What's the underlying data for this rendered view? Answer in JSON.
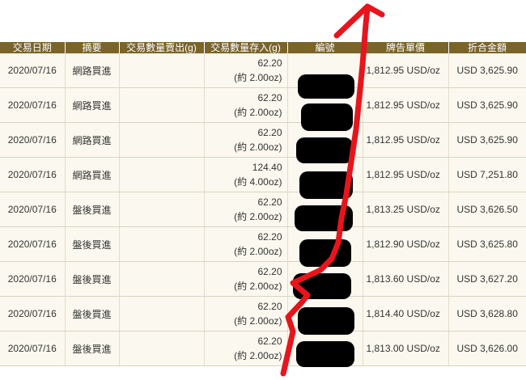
{
  "table": {
    "headers": [
      "交易日期",
      "摘要",
      "交易數量賣出(g)",
      "交易數量存入(g)",
      "編號",
      "牌告單價",
      "折合金額"
    ],
    "rows": [
      {
        "date": "2020/07/16",
        "summary": "網路買進",
        "qty_g": "62.20",
        "qty_oz": "(約 2.00oz)",
        "price": "1,812.95 USD/oz",
        "amount": "USD 3,625.90"
      },
      {
        "date": "2020/07/16",
        "summary": "網路買進",
        "qty_g": "62.20",
        "qty_oz": "(約 2.00oz)",
        "price": "1,812.95 USD/oz",
        "amount": "USD 3,625.90"
      },
      {
        "date": "2020/07/16",
        "summary": "網路買進",
        "qty_g": "62.20",
        "qty_oz": "(約 2.00oz)",
        "price": "1,812.95 USD/oz",
        "amount": "USD 3,625.90"
      },
      {
        "date": "2020/07/16",
        "summary": "網路買進",
        "qty_g": "124.40",
        "qty_oz": "(約 4.00oz)",
        "price": "1,812.95 USD/oz",
        "amount": "USD 7,251.80"
      },
      {
        "date": "2020/07/16",
        "summary": "盤後買進",
        "qty_g": "62.20",
        "qty_oz": "(約 2.00oz)",
        "price": "1,813.25 USD/oz",
        "amount": "USD 3,626.50"
      },
      {
        "date": "2020/07/16",
        "summary": "盤後買進",
        "qty_g": "62.20",
        "qty_oz": "(約 2.00oz)",
        "price": "1,812.90 USD/oz",
        "amount": "USD 3,625.80"
      },
      {
        "date": "2020/07/16",
        "summary": "盤後買進",
        "qty_g": "62.20",
        "qty_oz": "(約 2.00oz)",
        "price": "1,813.60 USD/oz",
        "amount": "USD 3,627.20"
      },
      {
        "date": "2020/07/16",
        "summary": "盤後買進",
        "qty_g": "62.20",
        "qty_oz": "(約 2.00oz)",
        "price": "1,814.40 USD/oz",
        "amount": "USD 3,628.80"
      },
      {
        "date": "2020/07/16",
        "summary": "盤後買進",
        "qty_g": "62.20",
        "qty_oz": "(約 2.00oz)",
        "price": "1,813.00 USD/oz",
        "amount": "USD 3,626.00"
      }
    ]
  },
  "annotation": {
    "redaction_color": "#000000",
    "arrow_color": "#e8141c",
    "arrow": "red-arrow-up-icon"
  },
  "colors": {
    "header_bg": "#7a6428",
    "row_bg": "#fbf9ef",
    "grid": "#d9d3c1"
  }
}
